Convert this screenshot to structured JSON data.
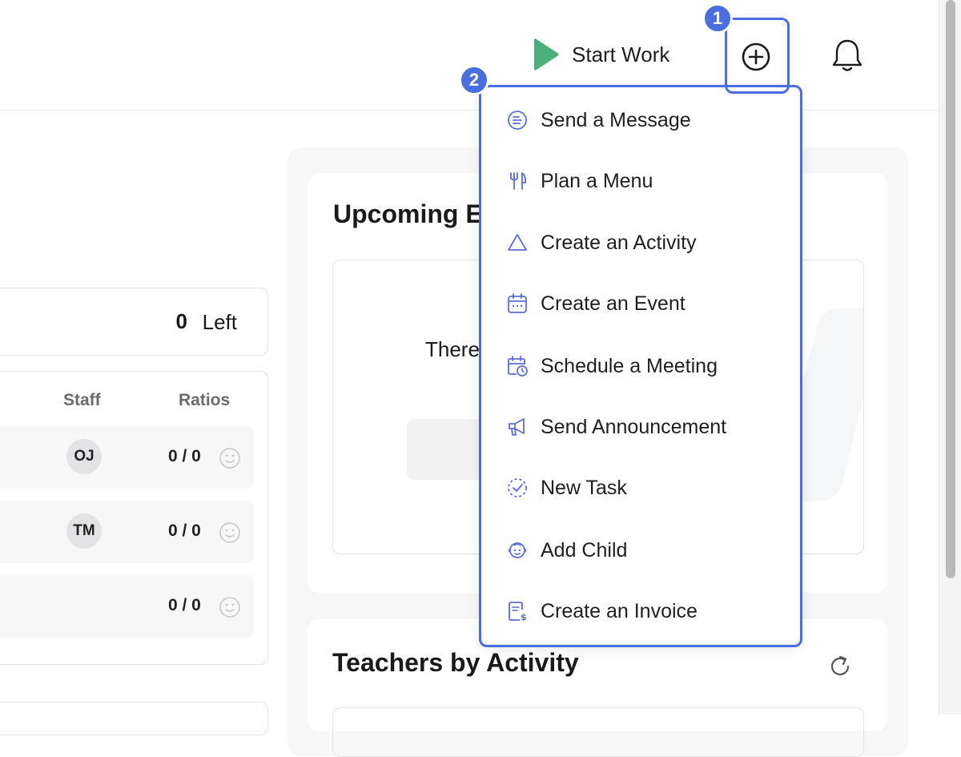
{
  "header": {
    "start_work_label": "Start Work"
  },
  "summary": {
    "count": "0",
    "left_label": "Left"
  },
  "staff_table": {
    "columns": [
      "Staff",
      "Ratios"
    ],
    "rows": [
      {
        "avatar": "OJ",
        "ratio": "0 / 0"
      },
      {
        "avatar": "TM",
        "ratio": "0 / 0"
      },
      {
        "avatar": "",
        "ratio": "0 / 0"
      }
    ]
  },
  "upcoming_events": {
    "title": "Upcoming E",
    "empty_text": "There"
  },
  "teachers_by_activity": {
    "title": "Teachers by Activity"
  },
  "add_menu": {
    "items": [
      {
        "label": "Send a Message",
        "icon": "message-icon"
      },
      {
        "label": "Plan a Menu",
        "icon": "utensils-icon"
      },
      {
        "label": "Create an Activity",
        "icon": "triangle-icon"
      },
      {
        "label": "Create an Event",
        "icon": "calendar-icon"
      },
      {
        "label": "Schedule a Meeting",
        "icon": "calendar-clock-icon"
      },
      {
        "label": "Send Announcement",
        "icon": "megaphone-icon"
      },
      {
        "label": "New Task",
        "icon": "task-check-icon"
      },
      {
        "label": "Add Child",
        "icon": "child-face-icon"
      },
      {
        "label": "Create an Invoice",
        "icon": "invoice-icon"
      }
    ]
  },
  "annotations": {
    "badge_1": "1",
    "badge_2": "2"
  },
  "colors": {
    "accent": "#4a6ee0",
    "menu_icon": "#5a6fd6",
    "start_work_green": "#4caf7a"
  }
}
